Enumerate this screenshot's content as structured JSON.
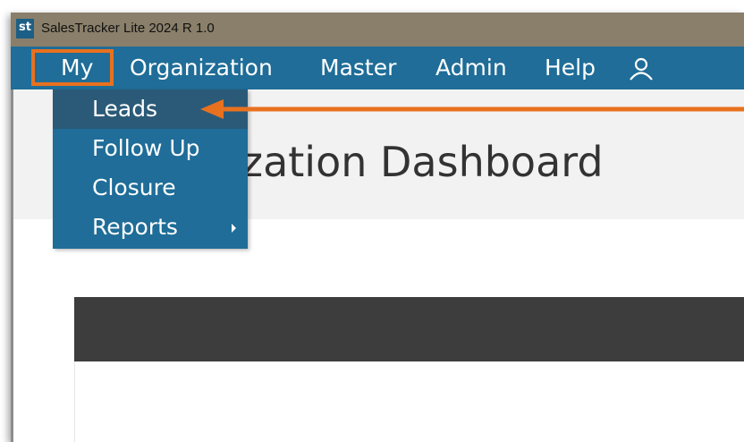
{
  "window": {
    "title": "SalesTracker Lite 2024 R 1.0",
    "logo_text": "st"
  },
  "menubar": {
    "items": [
      {
        "label": "My"
      },
      {
        "label": "Organization"
      },
      {
        "label": "Master"
      },
      {
        "label": "Admin"
      },
      {
        "label": "Help"
      }
    ],
    "user_icon": "user-icon"
  },
  "dropdown": {
    "items": [
      {
        "label": "Leads",
        "highlighted": true
      },
      {
        "label": "Follow Up"
      },
      {
        "label": "Closure"
      },
      {
        "label": "Reports",
        "has_submenu": true
      }
    ]
  },
  "page": {
    "title": "nization Dashboard"
  },
  "colors": {
    "titlebar": "#8a7f6a",
    "menubar": "#1f6d98",
    "dropdown_highlight": "#2b5a78",
    "annotation": "#e8711f",
    "dark_panel": "#3d3d3d"
  }
}
